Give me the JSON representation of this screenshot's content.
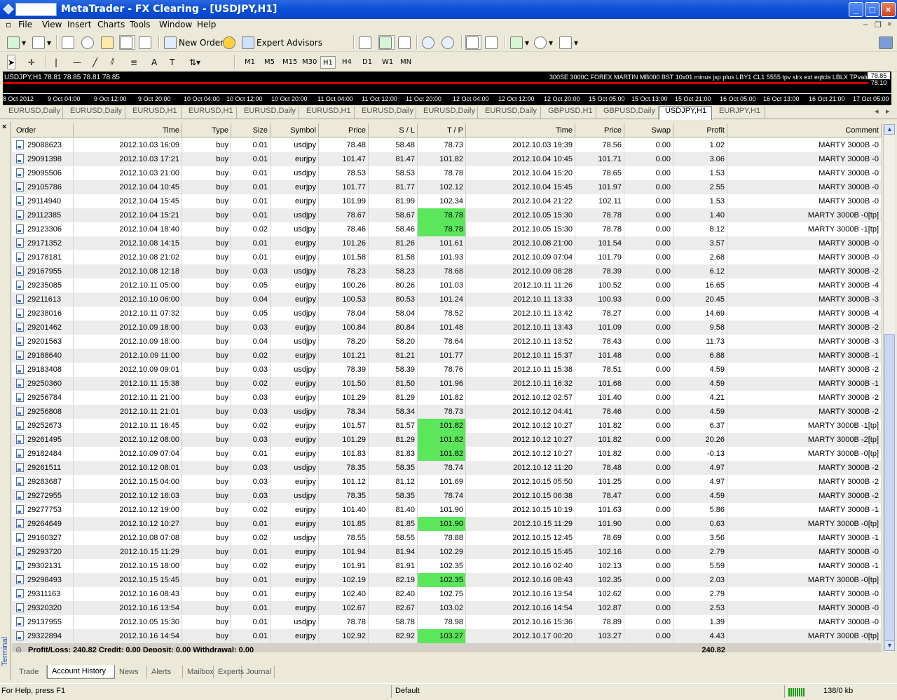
{
  "window": {
    "title": "MetaTrader - FX Clearing - [USDJPY,H1]"
  },
  "menu": [
    "File",
    "View",
    "Insert",
    "Charts",
    "Tools",
    "Window",
    "Help"
  ],
  "toolbar": {
    "new_order": "New Order",
    "expert_advisors": "Expert Advisors"
  },
  "timeframes": [
    "M1",
    "M5",
    "M15",
    "M30",
    "H1",
    "H4",
    "D1",
    "W1",
    "MN"
  ],
  "selected_timeframe": "H1",
  "chart": {
    "info": "USDJPY,H1  78.81 78.85 78.81 78.85",
    "ea_info": "300SE 3000C FOREX MARTIN MB000 BST 10x01 minus jsp plus LBY1 CL1 5555 tpv slrx ext eqtcls LBLX TPvalue",
    "price_top": "78.85",
    "price_bottom": "78.10",
    "time_labels": [
      "8 Oct 2012",
      "9 Oct 04:00",
      "9 Oct 12:00",
      "9 Oct 20:00",
      "10 Oct 04:00",
      "10 Oct 12:00",
      "10 Oct 20:00",
      "11 Oct 04:00",
      "11 Oct 12:00",
      "11 Oct 20:00",
      "12 Oct 04:00",
      "12 Oct 12:00",
      "12 Oct 20:00",
      "15 Oct 05:00",
      "15 Oct 13:00",
      "15 Oct 21:00",
      "16 Oct 05:00",
      "16 Oct 13:00",
      "16 Oct 21:00",
      "17 Oct 05:00"
    ]
  },
  "chart_tabs": [
    "EURUSD,Daily",
    "EURUSD,Daily",
    "EURUSD,H1",
    "EURUSD,H1",
    "EURUSD,Daily",
    "EURUSD,H1",
    "EURUSD,Daily",
    "EURUSD,Daily",
    "EURUSD,Daily",
    "GBPUSD,H1",
    "GBPUSD,Daily",
    "USDJPY,H1",
    "EURJPY,H1"
  ],
  "active_chart_tab": "USDJPY,H1",
  "terminal": {
    "label": "Terminal",
    "columns": [
      "Order",
      "Time",
      "Type",
      "Size",
      "Symbol",
      "Price",
      "S / L",
      "T / P",
      "Time",
      "Price",
      "Swap",
      "Profit",
      "Comment"
    ],
    "rows": [
      [
        "29088623",
        "2012.10.03 16:09",
        "buy",
        "0.01",
        "usdjpy",
        "78.48",
        "58.48",
        "78.73",
        "2012.10.03 19:39",
        "78.56",
        "0.00",
        "1.02",
        "MARTY 3000B -0"
      ],
      [
        "29091398",
        "2012.10.03 17:21",
        "buy",
        "0.01",
        "eurjpy",
        "101.47",
        "81.47",
        "101.82",
        "2012.10.04 10:45",
        "101.71",
        "0.00",
        "3.06",
        "MARTY 3000B -0"
      ],
      [
        "29095506",
        "2012.10.03 21:00",
        "buy",
        "0.01",
        "usdjpy",
        "78.53",
        "58.53",
        "78.78",
        "2012.10.04 15:20",
        "78.65",
        "0.00",
        "1.53",
        "MARTY 3000B -0"
      ],
      [
        "29105786",
        "2012.10.04 10:45",
        "buy",
        "0.01",
        "eurjpy",
        "101.77",
        "81.77",
        "102.12",
        "2012.10.04 15:45",
        "101.97",
        "0.00",
        "2.55",
        "MARTY 3000B -0"
      ],
      [
        "29114940",
        "2012.10.04 15:45",
        "buy",
        "0.01",
        "eurjpy",
        "101.99",
        "81.99",
        "102.34",
        "2012.10.04 21:22",
        "102.11",
        "0.00",
        "1.53",
        "MARTY 3000B -0"
      ],
      [
        "29112385",
        "2012.10.04 15:21",
        "buy",
        "0.01",
        "usdjpy",
        "78.67",
        "58.67",
        "78.78",
        "2012.10.05 15:30",
        "78.78",
        "0.00",
        "1.40",
        "MARTY 3000B -0[tp]"
      ],
      [
        "29123306",
        "2012.10.04 18:40",
        "buy",
        "0.02",
        "usdjpy",
        "78.46",
        "58.46",
        "78.78",
        "2012.10.05 15:30",
        "78.78",
        "0.00",
        "8.12",
        "MARTY 3000B -1[tp]"
      ],
      [
        "29171352",
        "2012.10.08 14:15",
        "buy",
        "0.01",
        "eurjpy",
        "101.26",
        "81.26",
        "101.61",
        "2012.10.08 21:00",
        "101.54",
        "0.00",
        "3.57",
        "MARTY 3000B -0"
      ],
      [
        "29178181",
        "2012.10.08 21:02",
        "buy",
        "0.01",
        "eurjpy",
        "101.58",
        "81.58",
        "101.93",
        "2012.10.09 07:04",
        "101.79",
        "0.00",
        "2.68",
        "MARTY 3000B -0"
      ],
      [
        "29167955",
        "2012.10.08 12:18",
        "buy",
        "0.03",
        "usdjpy",
        "78.23",
        "58.23",
        "78.68",
        "2012.10.09 08:28",
        "78.39",
        "0.00",
        "6.12",
        "MARTY 3000B -2"
      ],
      [
        "29235085",
        "2012.10.11 05:00",
        "buy",
        "0.05",
        "eurjpy",
        "100.26",
        "80.26",
        "101.03",
        "2012.10.11 11:26",
        "100.52",
        "0.00",
        "16.65",
        "MARTY 3000B -4"
      ],
      [
        "29211613",
        "2012.10.10 06:00",
        "buy",
        "0.04",
        "eurjpy",
        "100.53",
        "80.53",
        "101.24",
        "2012.10.11 13:33",
        "100.93",
        "0.00",
        "20.45",
        "MARTY 3000B -3"
      ],
      [
        "29238016",
        "2012.10.11 07:32",
        "buy",
        "0.05",
        "usdjpy",
        "78.04",
        "58.04",
        "78.52",
        "2012.10.11 13:42",
        "78.27",
        "0.00",
        "14.69",
        "MARTY 3000B -4"
      ],
      [
        "29201462",
        "2012.10.09 18:00",
        "buy",
        "0.03",
        "eurjpy",
        "100.84",
        "80.84",
        "101.48",
        "2012.10.11 13:43",
        "101.09",
        "0.00",
        "9.58",
        "MARTY 3000B -2"
      ],
      [
        "29201563",
        "2012.10.09 18:00",
        "buy",
        "0.04",
        "usdjpy",
        "78.20",
        "58.20",
        "78.64",
        "2012.10.11 13:52",
        "78.43",
        "0.00",
        "11.73",
        "MARTY 3000B -3"
      ],
      [
        "29188640",
        "2012.10.09 11:00",
        "buy",
        "0.02",
        "eurjpy",
        "101.21",
        "81.21",
        "101.77",
        "2012.10.11 15:37",
        "101.48",
        "0.00",
        "6.88",
        "MARTY 3000B -1"
      ],
      [
        "29183408",
        "2012.10.09 09:01",
        "buy",
        "0.03",
        "usdjpy",
        "78.39",
        "58.39",
        "78.76",
        "2012.10.11 15:38",
        "78.51",
        "0.00",
        "4.59",
        "MARTY 3000B -2"
      ],
      [
        "29250360",
        "2012.10.11 15:38",
        "buy",
        "0.02",
        "eurjpy",
        "101.50",
        "81.50",
        "101.96",
        "2012.10.11 16:32",
        "101.68",
        "0.00",
        "4.59",
        "MARTY 3000B -1"
      ],
      [
        "29256784",
        "2012.10.11 21:00",
        "buy",
        "0.03",
        "eurjpy",
        "101.29",
        "81.29",
        "101.82",
        "2012.10.12 02:57",
        "101.40",
        "0.00",
        "4.21",
        "MARTY 3000B -2"
      ],
      [
        "29256808",
        "2012.10.11 21:01",
        "buy",
        "0.03",
        "usdjpy",
        "78.34",
        "58.34",
        "78.73",
        "2012.10.12 04:41",
        "78.46",
        "0.00",
        "4.59",
        "MARTY 3000B -2"
      ],
      [
        "29252673",
        "2012.10.11 16:45",
        "buy",
        "0.02",
        "eurjpy",
        "101.57",
        "81.57",
        "101.82",
        "2012.10.12 10:27",
        "101.82",
        "0.00",
        "6.37",
        "MARTY 3000B -1[tp]"
      ],
      [
        "29261495",
        "2012.10.12 08:00",
        "buy",
        "0.03",
        "eurjpy",
        "101.29",
        "81.29",
        "101.82",
        "2012.10.12 10:27",
        "101.82",
        "0.00",
        "20.26",
        "MARTY 3000B -2[tp]"
      ],
      [
        "29182484",
        "2012.10.09 07:04",
        "buy",
        "0.01",
        "eurjpy",
        "101.83",
        "81.83",
        "101.82",
        "2012.10.12 10:27",
        "101.82",
        "0.00",
        "-0.13",
        "MARTY 3000B -0[tp]"
      ],
      [
        "29261511",
        "2012.10.12 08:01",
        "buy",
        "0.03",
        "usdjpy",
        "78.35",
        "58.35",
        "78.74",
        "2012.10.12 11:20",
        "78.48",
        "0.00",
        "4.97",
        "MARTY 3000B -2"
      ],
      [
        "29283687",
        "2012.10.15 04:00",
        "buy",
        "0.03",
        "eurjpy",
        "101.12",
        "81.12",
        "101.69",
        "2012.10.15 05:50",
        "101.25",
        "0.00",
        "4.97",
        "MARTY 3000B -2"
      ],
      [
        "29272955",
        "2012.10.12 16:03",
        "buy",
        "0.03",
        "usdjpy",
        "78.35",
        "58.35",
        "78.74",
        "2012.10.15 06:38",
        "78.47",
        "0.00",
        "4.59",
        "MARTY 3000B -2"
      ],
      [
        "29277753",
        "2012.10.12 19:00",
        "buy",
        "0.02",
        "eurjpy",
        "101.40",
        "81.40",
        "101.90",
        "2012.10.15 10:19",
        "101.63",
        "0.00",
        "5.86",
        "MARTY 3000B -1"
      ],
      [
        "29264649",
        "2012.10.12 10:27",
        "buy",
        "0.01",
        "eurjpy",
        "101.85",
        "81.85",
        "101.90",
        "2012.10.15 11:29",
        "101.90",
        "0.00",
        "0.63",
        "MARTY 3000B -0[tp]"
      ],
      [
        "29160327",
        "2012.10.08 07:08",
        "buy",
        "0.02",
        "usdjpy",
        "78.55",
        "58.55",
        "78.88",
        "2012.10.15 12:45",
        "78.69",
        "0.00",
        "3.56",
        "MARTY 3000B -1"
      ],
      [
        "29293720",
        "2012.10.15 11:29",
        "buy",
        "0.01",
        "eurjpy",
        "101.94",
        "81.94",
        "102.29",
        "2012.10.15 15:45",
        "102.16",
        "0.00",
        "2.79",
        "MARTY 3000B -0"
      ],
      [
        "29302131",
        "2012.10.15 18:00",
        "buy",
        "0.02",
        "eurjpy",
        "101.91",
        "81.91",
        "102.35",
        "2012.10.16 02:40",
        "102.13",
        "0.00",
        "5.59",
        "MARTY 3000B -1"
      ],
      [
        "29298493",
        "2012.10.15 15:45",
        "buy",
        "0.01",
        "eurjpy",
        "102.19",
        "82.19",
        "102.35",
        "2012.10.16 08:43",
        "102.35",
        "0.00",
        "2.03",
        "MARTY 3000B -0[tp]"
      ],
      [
        "29311163",
        "2012.10.16 08:43",
        "buy",
        "0.01",
        "eurjpy",
        "102.40",
        "82.40",
        "102.75",
        "2012.10.16 13:54",
        "102.62",
        "0.00",
        "2.79",
        "MARTY 3000B -0"
      ],
      [
        "29320320",
        "2012.10.16 13:54",
        "buy",
        "0.01",
        "eurjpy",
        "102.67",
        "82.67",
        "103.02",
        "2012.10.16 14:54",
        "102.87",
        "0.00",
        "2.53",
        "MARTY 3000B -0"
      ],
      [
        "29137955",
        "2012.10.05 15:30",
        "buy",
        "0.01",
        "usdjpy",
        "78.78",
        "58.78",
        "78.98",
        "2012.10.16 15:36",
        "78.89",
        "0.00",
        "1.39",
        "MARTY 3000B -0"
      ],
      [
        "29322894",
        "2012.10.16 14:54",
        "buy",
        "0.01",
        "eurjpy",
        "102.92",
        "82.92",
        "103.27",
        "2012.10.17 00:20",
        "103.27",
        "0.00",
        "4.43",
        "MARTY 3000B -0[tp]"
      ]
    ],
    "tp_hit_rows": [
      5,
      6,
      20,
      21,
      22,
      27,
      31,
      35
    ],
    "summary": {
      "text": "Profit/Loss: 240.82  Credit: 0.00  Deposit: 0.00  Withdrawal: 0.00",
      "total": "240.82"
    },
    "tabs": [
      "Trade",
      "Account History",
      "News",
      "Alerts",
      "Mailbox",
      "Experts",
      "Journal"
    ],
    "active_tab": "Account History"
  },
  "status": {
    "help": "For Help, press F1",
    "profile": "Default",
    "traffic": "138/0 kb"
  },
  "colors": {
    "tp_hit": "#5ce65c",
    "title_bar": "#0a4fd6",
    "chart_line": "#d00000"
  }
}
